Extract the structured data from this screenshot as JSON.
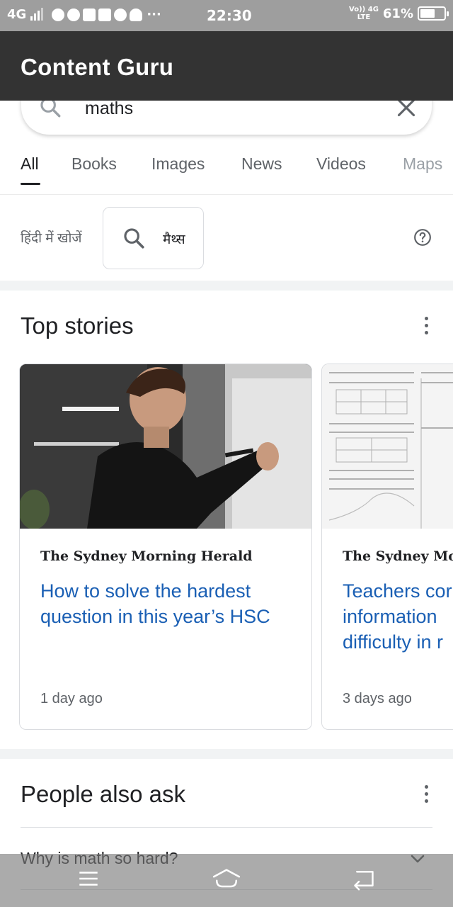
{
  "status_bar": {
    "network": "4G",
    "more": "···",
    "time": "22:30",
    "volte_top": "Vo)) 4G",
    "volte_bottom": "LTE",
    "battery_text": "61%",
    "battery_level": 0.61
  },
  "app_bar": {
    "title": "Content Guru"
  },
  "search": {
    "query": "maths"
  },
  "tabs": [
    "All",
    "Books",
    "Images",
    "News",
    "Videos",
    "Maps"
  ],
  "hindi": {
    "label": "हिंदी में खोजें",
    "chip_text": "मैथ्स"
  },
  "top_stories": {
    "title": "Top stories",
    "cards": [
      {
        "source": "The Sydney Morning Herald",
        "headline": "How to solve the hardest question in this year’s HSC",
        "time": "1 day ago"
      },
      {
        "source": "The Sydney Mornin",
        "headline": "Teachers cor information difficulty in r",
        "time": "3 days ago"
      }
    ]
  },
  "people_also_ask": {
    "title": "People also ask",
    "questions": [
      "Why is math so hard?"
    ]
  },
  "colors": {
    "app_bar": "#333333",
    "status_bar": "#9e9e9e",
    "link": "#1a5fb4",
    "nav_bar": "#787878"
  }
}
